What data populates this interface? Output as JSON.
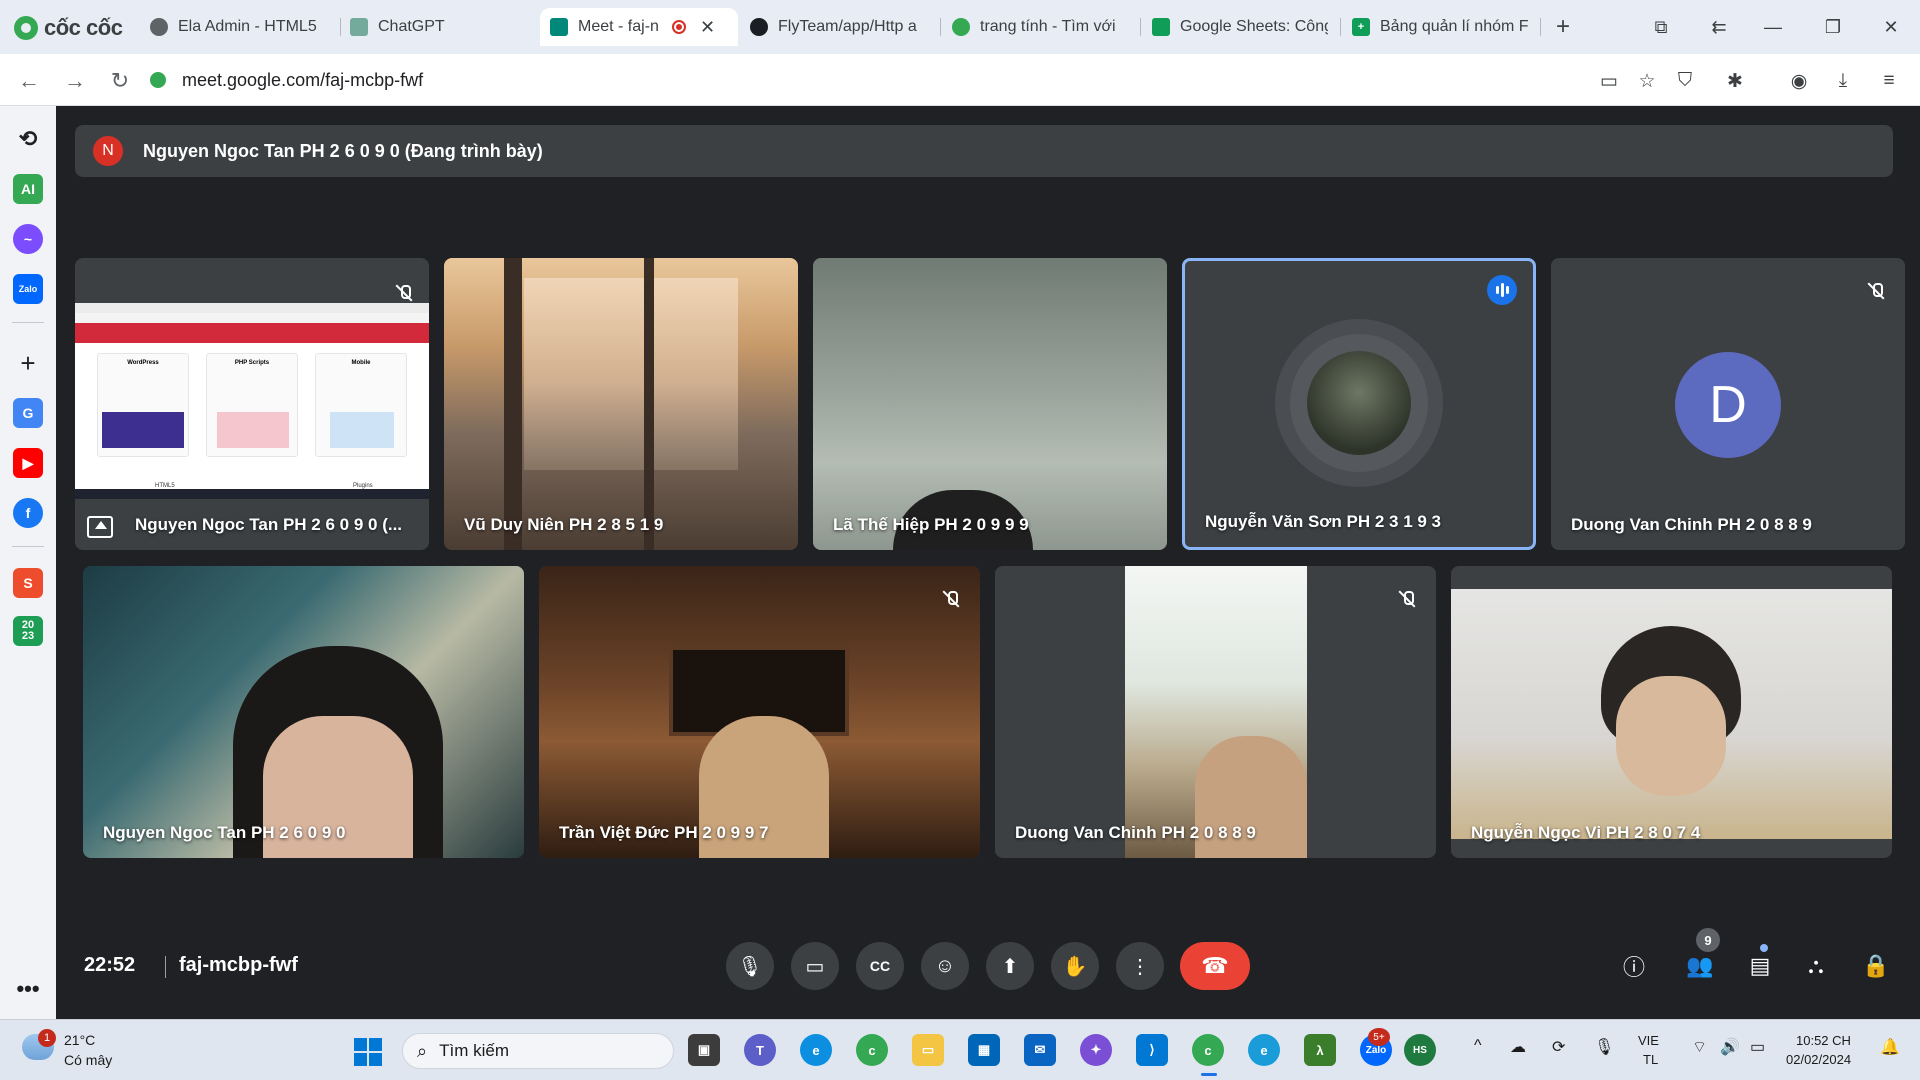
{
  "browser": {
    "brand": "cốc cốc",
    "tabs": [
      {
        "title": "Ela Admin - HTML5",
        "icon": "globe-icon"
      },
      {
        "title": "ChatGPT",
        "icon": "chatgpt-icon"
      },
      {
        "title": "Meet - faj-n",
        "icon": "google-meet-icon",
        "active": true
      },
      {
        "title": "FlyTeam/app/Http a",
        "icon": "github-icon"
      },
      {
        "title": "trang tính - Tìm với",
        "icon": "coccoc-search-icon"
      },
      {
        "title": "Google Sheets: Công",
        "icon": "sheets-icon"
      },
      {
        "title": "Bảng quản lí nhóm F",
        "icon": "sheets-plus-icon"
      }
    ],
    "url": "meet.google.com/faj-mcbp-fwf"
  },
  "meet": {
    "presenter_avatar_letter": "N",
    "presenter_banner": "Nguyen Ngoc Tan PH 2 6 0 9 0 (Đang trình bày)",
    "tiles_row1": [
      {
        "name": "Nguyen Ngoc Tan PH 2 6 0 9 0 (...",
        "muted": true,
        "kind": "presentation"
      },
      {
        "name": "Vũ Duy Niên PH 2 8 5 1 9",
        "muted": false,
        "kind": "video"
      },
      {
        "name": "Lã Thế Hiệp PH 2 0 9 9 9",
        "muted": false,
        "kind": "video"
      },
      {
        "name": "Nguyễn Văn Sơn PH 2 3 1 9 3",
        "muted": false,
        "kind": "avatar",
        "speaking": true
      },
      {
        "name": "Duong Van Chinh PH 2 0 8 8 9",
        "muted": true,
        "kind": "letter",
        "letter": "D"
      }
    ],
    "tiles_row2": [
      {
        "name": "Nguyen Ngoc Tan PH 2 6 0 9 0",
        "muted": false
      },
      {
        "name": "Trần Việt Đức PH 2 0 9 9 7",
        "muted": true
      },
      {
        "name": "Duong Van Chinh PH 2 0 8 8 9",
        "muted": true
      },
      {
        "name": "Nguyễn Ngọc Vi PH 2 8 0 7 4",
        "muted": false
      }
    ],
    "presentation_cards": [
      "WordPress",
      "PHP Scripts",
      "Mobile"
    ],
    "presentation_footer": [
      "HTML5",
      "Plugins"
    ],
    "time": "22:52",
    "meeting_code": "faj-mcbp-fwf",
    "people_count": "9",
    "colors": {
      "end_call": "#ea4335",
      "speaking": "#1a73e8",
      "avatar_letter_bg": "#5c6bc0"
    }
  },
  "sidepanel": [
    "history-icon",
    "ai-icon",
    "messenger-icon",
    "zalo-icon",
    "add-icon",
    "translate-icon",
    "youtube-icon",
    "facebook-icon",
    "shopee-icon",
    "calendar-2023-icon",
    "more-icon"
  ],
  "sidepanel_labels": {
    "ai": "AI",
    "zalo": "Zalo",
    "shopee": "S",
    "calendar_top": "20",
    "calendar_bottom": "23"
  },
  "taskbar": {
    "weather_badge": "1",
    "temperature": "21°C",
    "weather": "Có mây",
    "search_placeholder": "Tìm kiếm",
    "zalo_badge": "5+",
    "lang_top": "VIE",
    "lang_bottom": "TL",
    "time": "10:52 CH",
    "date": "02/02/2024"
  }
}
